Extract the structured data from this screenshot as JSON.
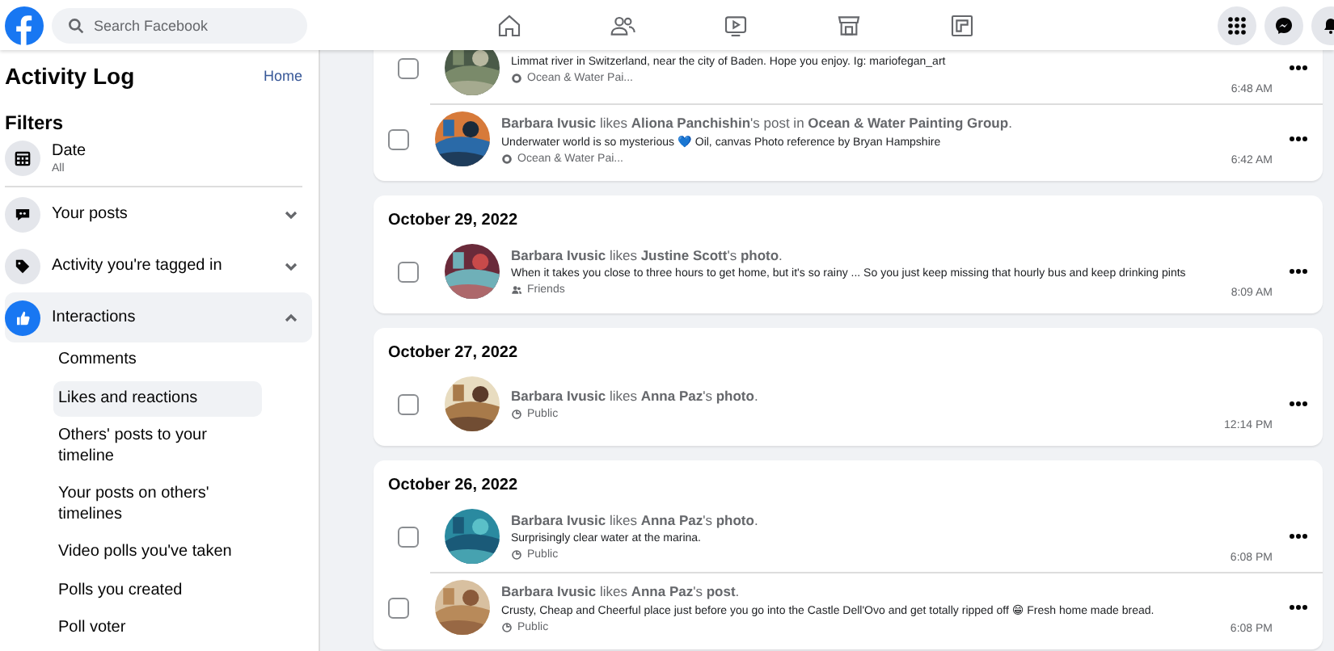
{
  "header": {
    "search": {
      "placeholder": "Search Facebook"
    },
    "nav": [
      {
        "kind": "home"
      },
      {
        "kind": "friends"
      },
      {
        "kind": "video"
      },
      {
        "kind": "marketplace"
      },
      {
        "kind": "gaming"
      }
    ],
    "actions": [
      {
        "kind": "menu"
      },
      {
        "kind": "messenger"
      },
      {
        "kind": "notifications"
      }
    ]
  },
  "sidebar": {
    "title": "Activity Log",
    "home_link": "Home",
    "filters_heading": "Filters",
    "date_filter": {
      "label": "Date",
      "value": "All"
    },
    "categories": [
      {
        "label": "Your posts",
        "kind": "posts",
        "expanded": false
      },
      {
        "label": "Activity you're tagged in",
        "kind": "tag",
        "expanded": false
      },
      {
        "label": "Interactions",
        "kind": "like",
        "expanded": true
      }
    ],
    "subitems": [
      {
        "label": "Comments",
        "selected": false
      },
      {
        "label": "Likes and reactions",
        "selected": true
      },
      {
        "label": "Others' posts to your timeline",
        "selected": false
      },
      {
        "label": "Your posts on others' timelines",
        "selected": false
      },
      {
        "label": "Video polls you've taken",
        "selected": false
      },
      {
        "label": "Polls you created",
        "selected": false
      },
      {
        "label": "Poll voter",
        "selected": false
      }
    ]
  },
  "feed": [
    {
      "items": [
        {
          "description": "Limmat river in Switzerland, near the city of Baden. Hope you enjoy. Ig: mariofegan_art",
          "audience": {
            "kind": "group",
            "label": "Ocean & Water Pai..."
          },
          "time": "6:48 AM",
          "checked": false
        },
        {
          "title": "**Barbara Ivusic** likes **Aliona Panchishin**'s post in **Ocean & Water Painting Group**.",
          "description": "Underwater world is so mysterious 💙 Oil, canvas Photo reference by Bryan Hampshire",
          "audience": {
            "kind": "group",
            "label": "Ocean & Water Pai..."
          },
          "time": "6:42 AM",
          "checked": false
        }
      ]
    },
    {
      "date": "October 29, 2022",
      "items": [
        {
          "title": "**Barbara Ivusic** likes **Justine Scott**'s **photo**.",
          "description": "When it takes you close to three hours to get home, but it's so rainy ... So you just keep missing that hourly bus and keep drinking pints",
          "audience": {
            "kind": "friends",
            "label": "Friends"
          },
          "time": "8:09 AM",
          "checked": false
        }
      ]
    },
    {
      "date": "October 27, 2022",
      "items": [
        {
          "title": "**Barbara Ivusic** likes **Anna Paz**'s **photo**.",
          "audience": {
            "kind": "public",
            "label": "Public"
          },
          "time": "12:14 PM",
          "checked": false
        }
      ]
    },
    {
      "date": "October 26, 2022",
      "items": [
        {
          "title": "**Barbara Ivusic** likes **Anna Paz**'s **photo**.",
          "description": "Surprisingly clear water at the marina.",
          "audience": {
            "kind": "public",
            "label": "Public"
          },
          "time": "6:08 PM",
          "checked": false
        },
        {
          "title": "**Barbara Ivusic** likes **Anna Paz**'s **post**.",
          "description": "Crusty, Cheap and Cheerful place just before you go into the Castle Dell'Ovo and get totally ripped off 😁 Fresh home made bread.",
          "audience": {
            "kind": "public",
            "label": "Public"
          },
          "time": "6:08 PM",
          "checked": false
        }
      ]
    }
  ]
}
